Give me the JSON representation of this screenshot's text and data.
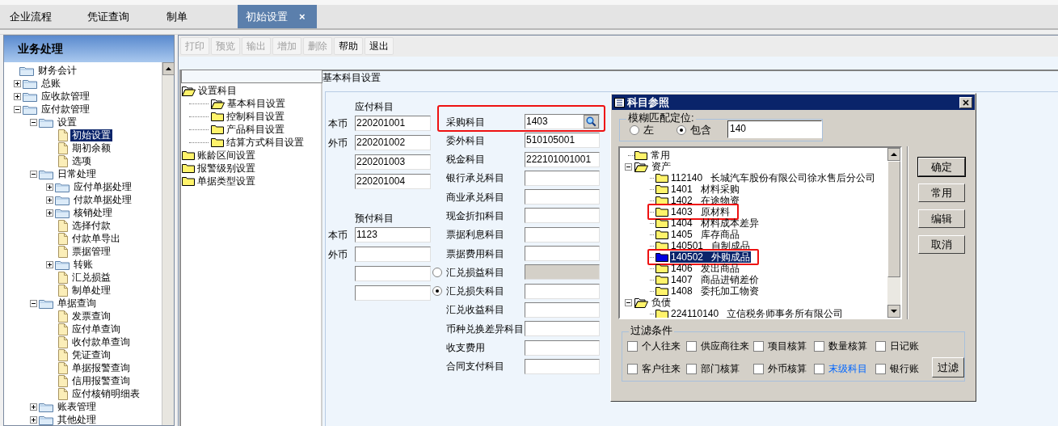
{
  "tabs": [
    {
      "label": "企业流程",
      "selected": false
    },
    {
      "label": "凭证查询",
      "selected": false
    },
    {
      "label": "制单",
      "selected": false
    },
    {
      "label": "初始设置",
      "selected": true,
      "close": "×"
    }
  ],
  "sidebar": {
    "title": "业务处理",
    "tree": [
      {
        "label": "财务会计",
        "kind": "folder",
        "selected": false,
        "children": [
          {
            "label": "总账",
            "kind": "folder",
            "expanded": false,
            "selected": false
          },
          {
            "label": "应收款管理",
            "kind": "folder",
            "expanded": false,
            "selected": false
          },
          {
            "label": "应付款管理",
            "kind": "folder",
            "expanded": true,
            "selected": false,
            "children": [
              {
                "label": "设置",
                "kind": "folder",
                "expanded": true,
                "selected": false,
                "children": [
                  {
                    "label": "初始设置",
                    "kind": "doc",
                    "selected": true
                  },
                  {
                    "label": "期初余额",
                    "kind": "doc",
                    "selected": false
                  },
                  {
                    "label": "选项",
                    "kind": "doc",
                    "selected": false
                  }
                ]
              },
              {
                "label": "日常处理",
                "kind": "folder",
                "expanded": true,
                "selected": false,
                "children": [
                  {
                    "label": "应付单据处理",
                    "kind": "folder",
                    "expanded": false,
                    "selected": false
                  },
                  {
                    "label": "付款单据处理",
                    "kind": "folder",
                    "expanded": false,
                    "selected": false
                  },
                  {
                    "label": "核销处理",
                    "kind": "folder",
                    "expanded": false,
                    "selected": false
                  },
                  {
                    "label": "选择付款",
                    "kind": "doc",
                    "selected": false
                  },
                  {
                    "label": "付款单导出",
                    "kind": "doc",
                    "selected": false
                  },
                  {
                    "label": "票据管理",
                    "kind": "doc",
                    "selected": false
                  },
                  {
                    "label": "转账",
                    "kind": "folder",
                    "expanded": false,
                    "selected": false
                  },
                  {
                    "label": "汇兑损益",
                    "kind": "doc",
                    "selected": false
                  },
                  {
                    "label": "制单处理",
                    "kind": "doc",
                    "selected": false
                  }
                ]
              },
              {
                "label": "单据查询",
                "kind": "folder",
                "expanded": true,
                "selected": false,
                "children": [
                  {
                    "label": "发票查询",
                    "kind": "doc",
                    "selected": false
                  },
                  {
                    "label": "应付单查询",
                    "kind": "doc",
                    "selected": false
                  },
                  {
                    "label": "收付款单查询",
                    "kind": "doc",
                    "selected": false
                  },
                  {
                    "label": "凭证查询",
                    "kind": "doc",
                    "selected": false
                  },
                  {
                    "label": "单据报警查询",
                    "kind": "doc",
                    "selected": false
                  },
                  {
                    "label": "信用报警查询",
                    "kind": "doc",
                    "selected": false
                  },
                  {
                    "label": "应付核销明细表",
                    "kind": "doc",
                    "selected": false
                  }
                ]
              },
              {
                "label": "账表管理",
                "kind": "folder",
                "expanded": false,
                "selected": false
              },
              {
                "label": "其他处理",
                "kind": "folder",
                "expanded": false,
                "selected": false
              }
            ]
          }
        ]
      }
    ]
  },
  "toolbar": [
    {
      "label": "打印",
      "disabled": true
    },
    {
      "label": "预览",
      "disabled": true
    },
    {
      "label": "输出",
      "disabled": true
    },
    {
      "label": "增加",
      "disabled": true
    },
    {
      "label": "删除",
      "disabled": true
    },
    {
      "label": "帮助",
      "disabled": false
    },
    {
      "label": "退出",
      "disabled": false
    }
  ],
  "settings_tree": [
    {
      "label": "设置科目",
      "kind": "open-folder",
      "children": [
        {
          "label": "基本科目设置",
          "kind": "open-folder"
        },
        {
          "label": "控制科目设置",
          "kind": "folder"
        },
        {
          "label": "产品科目设置",
          "kind": "folder"
        },
        {
          "label": "结算方式科目设置",
          "kind": "folder"
        }
      ]
    },
    {
      "label": "账龄区间设置",
      "kind": "folder"
    },
    {
      "label": "报警级别设置",
      "kind": "folder"
    },
    {
      "label": "单据类型设置",
      "kind": "folder"
    }
  ],
  "form": {
    "title": "基本科目设置",
    "payable": {
      "heading": "应付科目",
      "rows": [
        {
          "label": "本币",
          "value": "220201001"
        },
        {
          "label": "外币",
          "value": "220201002"
        },
        {
          "value": "220201003"
        },
        {
          "value": "220201004"
        }
      ]
    },
    "prepaid": {
      "heading": "预付科目",
      "rows": [
        {
          "label": "本币",
          "value": "1123"
        },
        {
          "label": "外币"
        },
        {},
        {}
      ]
    },
    "accounts": [
      {
        "label": "采购科目",
        "value": "1403",
        "kind": "lookup",
        "highlighted": true,
        "disabled": false
      },
      {
        "label": "委外科目",
        "value": "510105001",
        "kind": "plain",
        "highlighted": false,
        "disabled": false
      },
      {
        "label": "税金科目",
        "value": "222101001001",
        "kind": "plain",
        "highlighted": false,
        "disabled": false
      },
      {
        "label": "银行承兑科目",
        "kind": "plain",
        "highlighted": false,
        "disabled": false
      },
      {
        "label": "商业承兑科目",
        "kind": "plain",
        "highlighted": false,
        "disabled": false
      },
      {
        "label": "现金折扣科目",
        "kind": "plain",
        "highlighted": false,
        "disabled": false
      },
      {
        "label": "票据利息科目",
        "kind": "plain",
        "highlighted": false,
        "disabled": false
      },
      {
        "label": "票据费用科目",
        "kind": "plain",
        "highlighted": false,
        "disabled": false
      },
      {
        "label": "汇兑损益科目",
        "kind": "radio",
        "selected": false,
        "highlighted": false,
        "disabled": true
      },
      {
        "label": "汇兑损失科目",
        "kind": "radio",
        "selected": true,
        "highlighted": false,
        "disabled": false
      },
      {
        "label": "汇兑收益科目",
        "kind": "plain",
        "highlighted": false,
        "disabled": false
      },
      {
        "label": "币种兑换差异科目",
        "kind": "plain",
        "highlighted": false,
        "disabled": false
      },
      {
        "label": "收支费用",
        "kind": "plain",
        "highlighted": false,
        "disabled": false
      },
      {
        "label": "合同支付科目",
        "kind": "plain",
        "highlighted": false,
        "disabled": false
      }
    ]
  },
  "dialog": {
    "title": "科目参照",
    "match": {
      "legend": "模糊匹配定位:",
      "options": [
        {
          "label": "左",
          "selected": false
        },
        {
          "label": "包含",
          "selected": true
        }
      ],
      "value": "140"
    },
    "tree": [
      {
        "label": "常用",
        "kind": "folder"
      },
      {
        "label": "资产",
        "kind": "open-folder",
        "expanded": true,
        "children": [
          {
            "code": "112140",
            "name": "长城汽车股份有限公司徐水售后分公司",
            "selected": false,
            "highlighted": false
          },
          {
            "code": "1401",
            "name": "材料采购",
            "selected": false,
            "highlighted": false
          },
          {
            "code": "1402",
            "name": "在途物资",
            "selected": false,
            "highlighted": false
          },
          {
            "code": "1403",
            "name": "原材料",
            "selected": false,
            "highlighted": true
          },
          {
            "code": "1404",
            "name": "材料成本差异",
            "selected": false,
            "highlighted": false
          },
          {
            "code": "1405",
            "name": "库存商品",
            "selected": false,
            "highlighted": false
          },
          {
            "code": "140501",
            "name": "自制成品",
            "selected": false,
            "highlighted": false
          },
          {
            "code": "140502",
            "name": "外购成品",
            "selected": true,
            "highlighted": true
          },
          {
            "code": "1406",
            "name": "发出商品",
            "selected": false,
            "highlighted": false
          },
          {
            "code": "1407",
            "name": "商品进销差价",
            "selected": false,
            "highlighted": false
          },
          {
            "code": "1408",
            "name": "委托加工物资",
            "selected": false,
            "highlighted": false
          }
        ]
      },
      {
        "label": "负债",
        "kind": "open-folder",
        "expanded": true,
        "children": [
          {
            "code": "224110140",
            "name": "立信税务师事务所有限公司",
            "selected": false,
            "highlighted": false
          }
        ]
      }
    ],
    "buttons": [
      {
        "label": "确定",
        "default": true
      },
      {
        "label": "常用",
        "default": false
      },
      {
        "label": "编辑",
        "default": false
      },
      {
        "label": "取消",
        "default": false
      }
    ],
    "filter": {
      "legend": "过滤条件",
      "options": [
        {
          "label": "个人往来",
          "checked": false
        },
        {
          "label": "供应商往来",
          "checked": false
        },
        {
          "label": "项目核算",
          "checked": false
        },
        {
          "label": "数量核算",
          "checked": false
        },
        {
          "label": "日记账",
          "checked": false
        },
        {
          "label": "客户往来",
          "checked": false
        },
        {
          "label": "部门核算",
          "checked": false
        },
        {
          "label": "外币核算",
          "checked": false
        },
        {
          "label": "末级科目",
          "checked": false,
          "color": "#0066ff"
        },
        {
          "label": "银行账",
          "checked": false
        }
      ],
      "button": "过滤"
    }
  }
}
